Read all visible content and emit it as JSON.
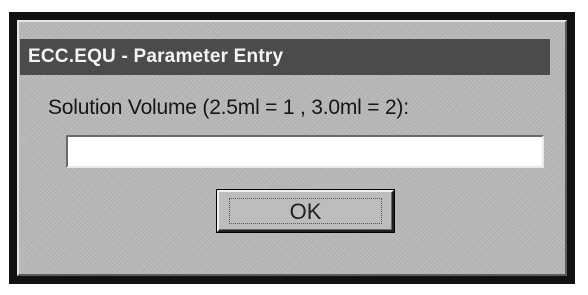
{
  "dialog": {
    "title": "ECC.EQU - Parameter Entry",
    "prompt": "Solution Volume (2.5ml = 1 , 3.0ml = 2):",
    "entry_value": "",
    "ok_label": "OK"
  },
  "colors": {
    "titlebar": "#4a4a4a",
    "dialog_face": "#b9b9b9",
    "field_background": "#ffffff"
  }
}
